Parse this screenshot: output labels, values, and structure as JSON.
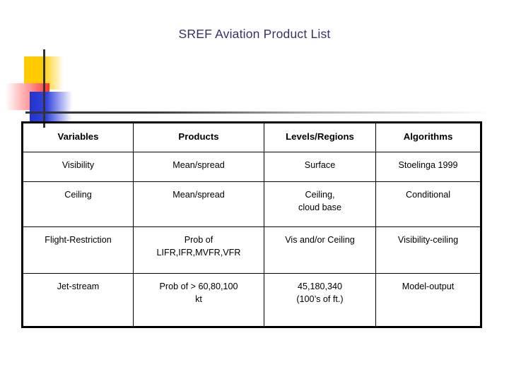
{
  "slide": {
    "title": "SREF Aviation Product List",
    "title_color": "#333366"
  },
  "decoration": {
    "name": "powerpoint-template-accent",
    "colors": {
      "yellow": "#FFCC00",
      "red": "#FF3333",
      "blue": "#2233CC",
      "line": "#333333"
    }
  },
  "table": {
    "headers": [
      "Variables",
      "Products",
      "Levels/Regions",
      "Algorithms"
    ],
    "rows": [
      {
        "variable": "Visibility",
        "product_line1": "Mean/spread",
        "product_line2": "",
        "level_line1": "Surface",
        "level_line2": "",
        "algorithm": "Stoelinga 1999"
      },
      {
        "variable": "Ceiling",
        "product_line1": "Mean/spread",
        "product_line2": "",
        "level_line1": "Ceiling,",
        "level_line2": "cloud base",
        "algorithm": "Conditional"
      },
      {
        "variable": "Flight-Restriction",
        "product_line1": "Prob of",
        "product_line2": "LIFR,IFR,MVFR,VFR",
        "level_line1": "Vis and/or Ceiling",
        "level_line2": "",
        "algorithm": "Visibility-ceiling"
      },
      {
        "variable": "Jet-stream",
        "product_line1": "Prob of > 60,80,100",
        "product_line2": "kt",
        "level_line1": "45,180,340",
        "level_line2": "(100’s of ft.)",
        "algorithm": "Model-output"
      }
    ]
  }
}
